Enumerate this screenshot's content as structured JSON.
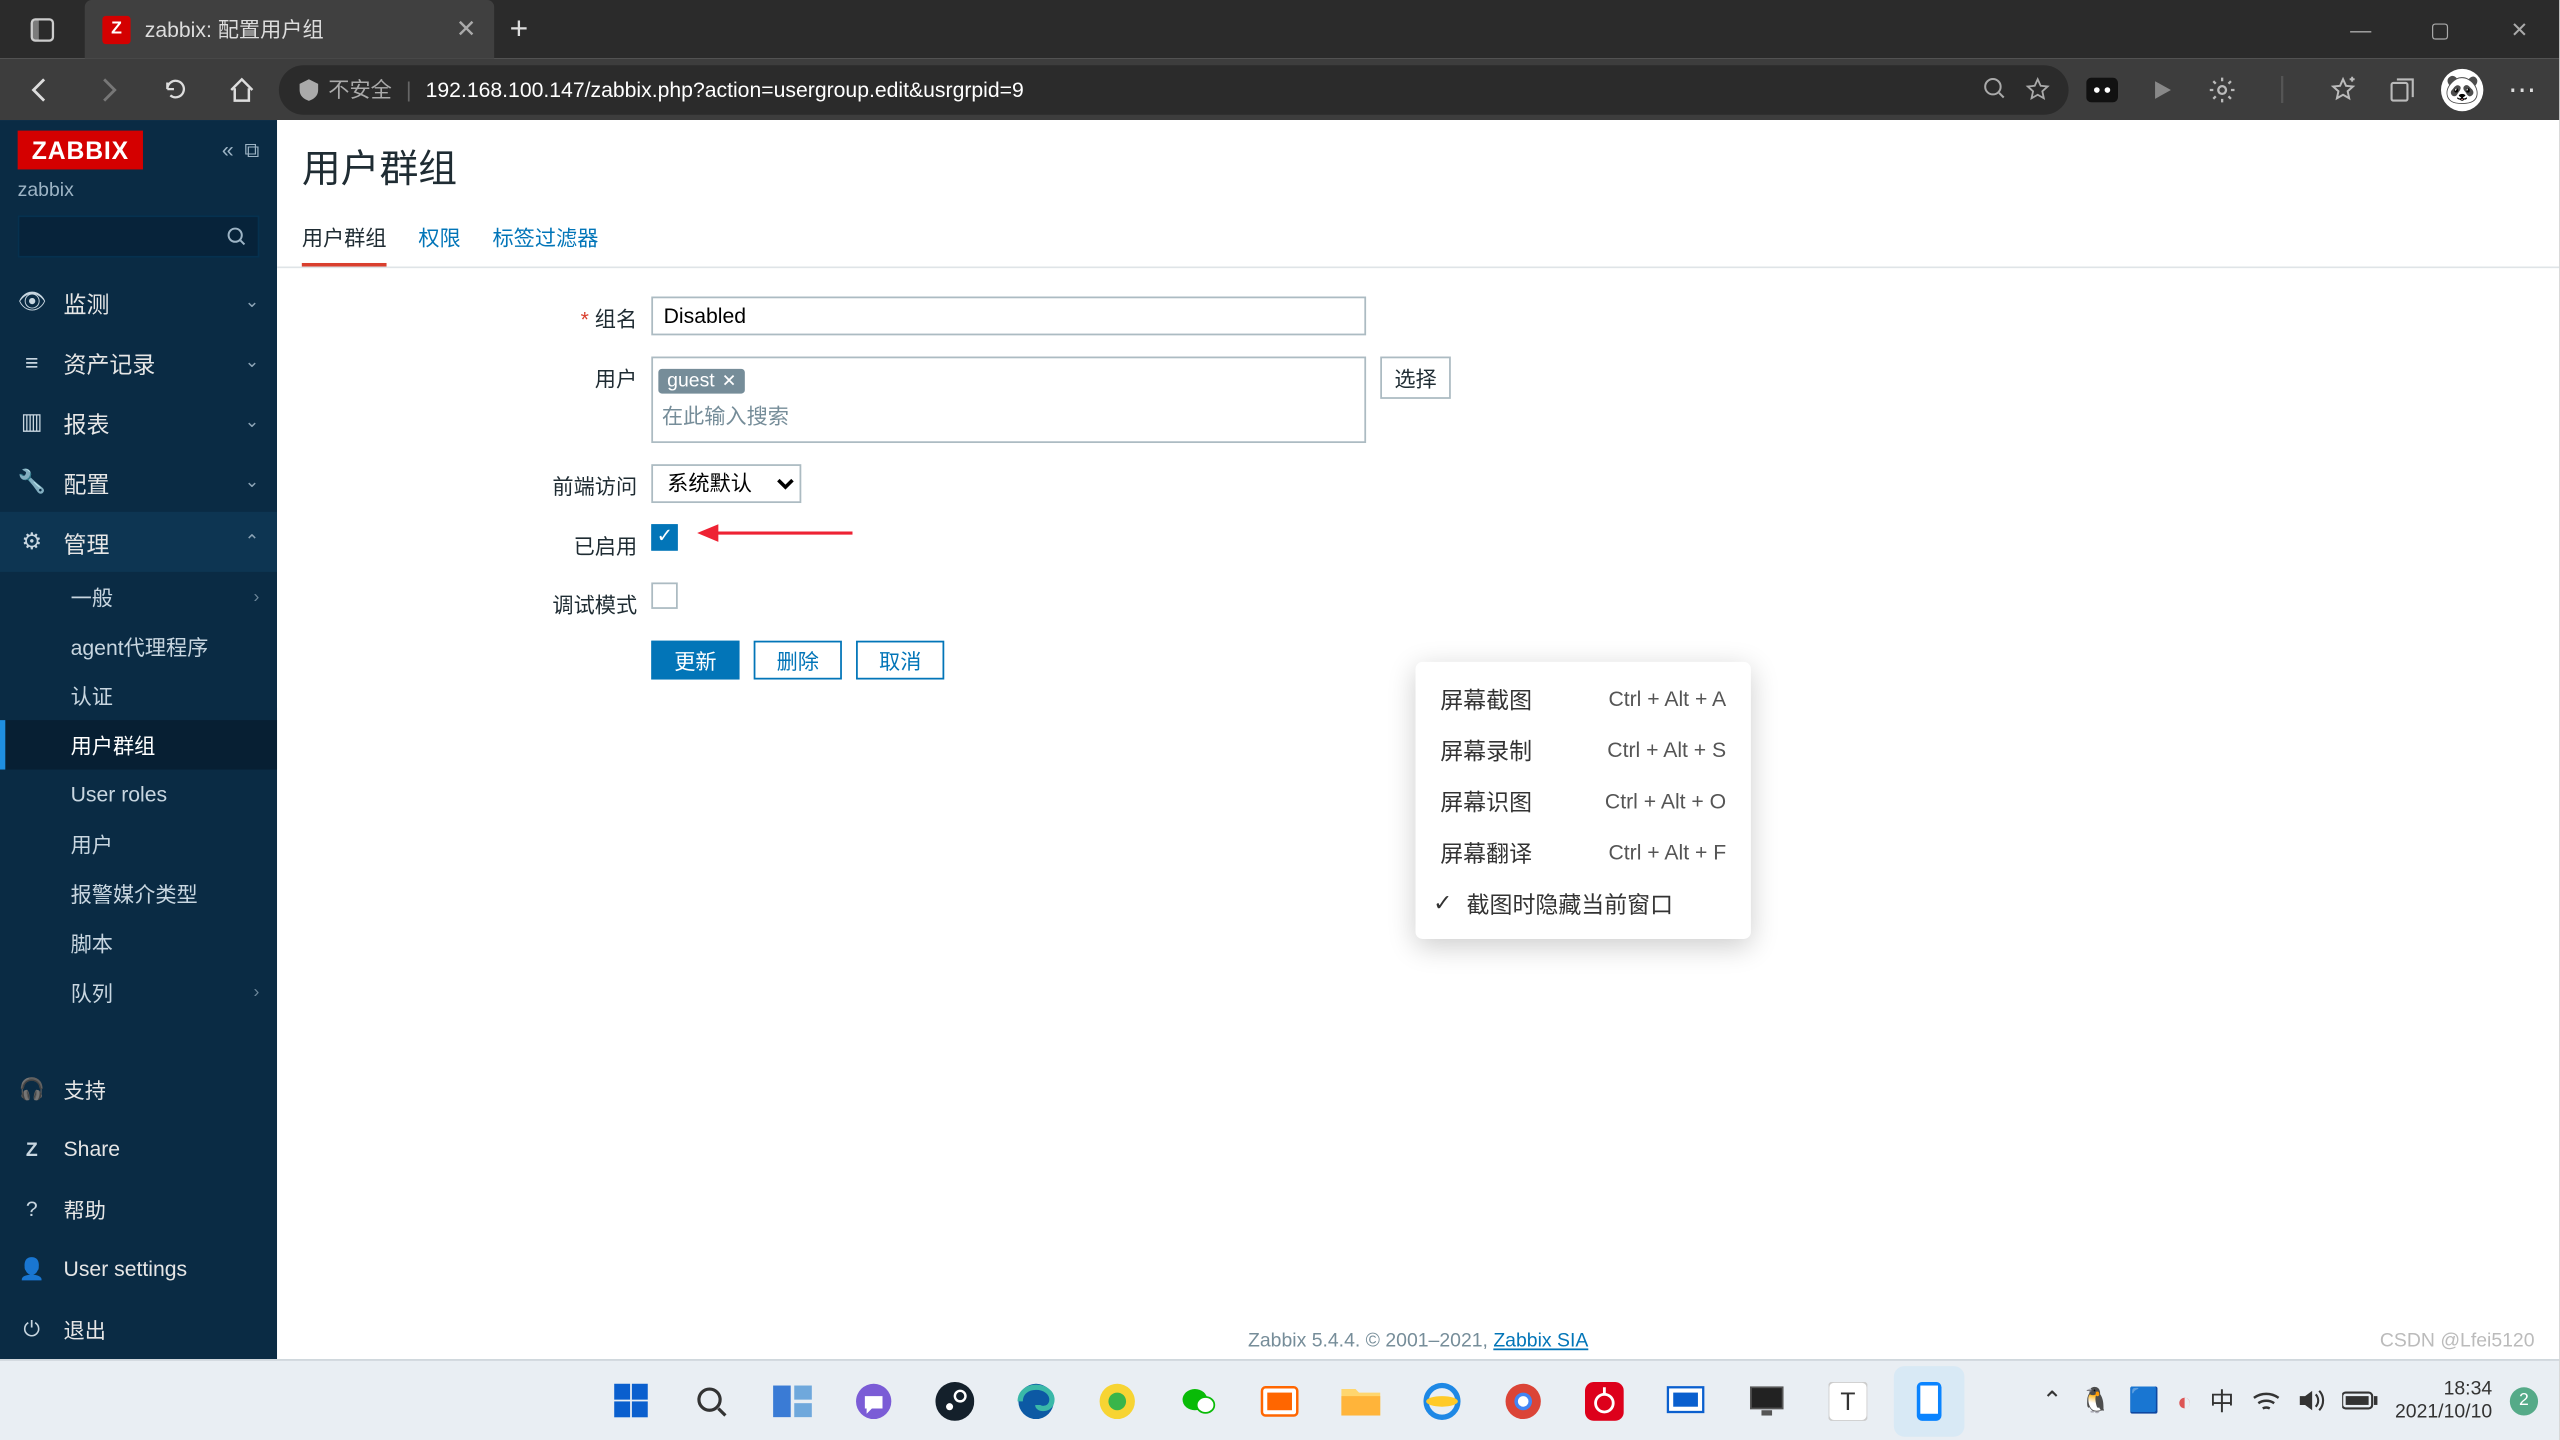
{
  "browser": {
    "tab_title": "zabbix: 配置用户组",
    "security_label": "不安全",
    "url": "192.168.100.147/zabbix.php?action=usergroup.edit&usrgrpid=9"
  },
  "sidebar": {
    "logo": "ZABBIX",
    "server": "zabbix",
    "menu": [
      {
        "icon": "👁",
        "label": "监测"
      },
      {
        "icon": "≡",
        "label": "资产记录"
      },
      {
        "icon": "▥",
        "label": "报表"
      },
      {
        "icon": "🔧",
        "label": "配置"
      },
      {
        "icon": "⚙",
        "label": "管理"
      }
    ],
    "submenu": [
      {
        "label": "一般",
        "chev": true
      },
      {
        "label": "agent代理程序"
      },
      {
        "label": "认证"
      },
      {
        "label": "用户群组",
        "active": true
      },
      {
        "label": "User roles"
      },
      {
        "label": "用户"
      },
      {
        "label": "报警媒介类型"
      },
      {
        "label": "脚本"
      },
      {
        "label": "队列",
        "chev": true
      }
    ],
    "bottom": [
      {
        "icon": "⎋",
        "label": "支持"
      },
      {
        "icon": "Z",
        "label": "Share"
      },
      {
        "icon": "?",
        "label": "帮助"
      },
      {
        "icon": "👤",
        "label": "User settings"
      },
      {
        "icon": "⏻",
        "label": "退出"
      }
    ]
  },
  "page": {
    "title": "用户群组",
    "tabs": [
      "用户群组",
      "权限",
      "标签过滤器"
    ],
    "form": {
      "group_name_label": "组名",
      "group_name_value": "Disabled",
      "users_label": "用户",
      "user_tag": "guest",
      "users_placeholder": "在此输入搜索",
      "select_btn": "选择",
      "frontend_label": "前端访问",
      "frontend_value": "系统默认",
      "enabled_label": "已启用",
      "debug_label": "调试模式",
      "btn_update": "更新",
      "btn_delete": "删除",
      "btn_cancel": "取消"
    },
    "footer_text": "Zabbix 5.4.4. © 2001–2021, ",
    "footer_link": "Zabbix SIA"
  },
  "context_menu": [
    {
      "label": "屏幕截图",
      "key": "Ctrl + Alt + A"
    },
    {
      "label": "屏幕录制",
      "key": "Ctrl + Alt + S"
    },
    {
      "label": "屏幕识图",
      "key": "Ctrl + Alt + O"
    },
    {
      "label": "屏幕翻译",
      "key": "Ctrl + Alt + F"
    },
    {
      "label": "截图时隐藏当前窗口",
      "check": true
    }
  ],
  "taskbar": {
    "time": "18:34",
    "date": "2021/10/10",
    "ime": "中",
    "badge": "2"
  },
  "watermark": "CSDN @Lfei5120"
}
